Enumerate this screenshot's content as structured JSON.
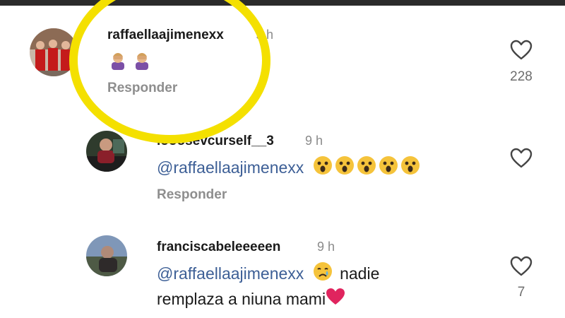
{
  "comments": [
    {
      "username": "raffaellaajimenexx",
      "time": "9 h",
      "reply_label": "Responder",
      "likes": "228"
    },
    {
      "username": "looosevcurself__3",
      "time": "9 h",
      "mention": "@raffaellaajimenexx",
      "reply_label": "Responder"
    },
    {
      "username": "franciscabeleeeeen",
      "time": "9 h",
      "mention": "@raffaellaajimenexx",
      "text_line1": "nadie",
      "text_line2": "remplaza a niuna mami",
      "likes": "7"
    }
  ],
  "colors": {
    "highlight_ring": "#f4e000",
    "mention": "#3d5f96",
    "heart_emoji": "#e0245e"
  },
  "icons": [
    "heart-outline-icon",
    "facepalm-emoji",
    "astonished-emoji",
    "crying-emoji",
    "red-heart-emoji"
  ]
}
